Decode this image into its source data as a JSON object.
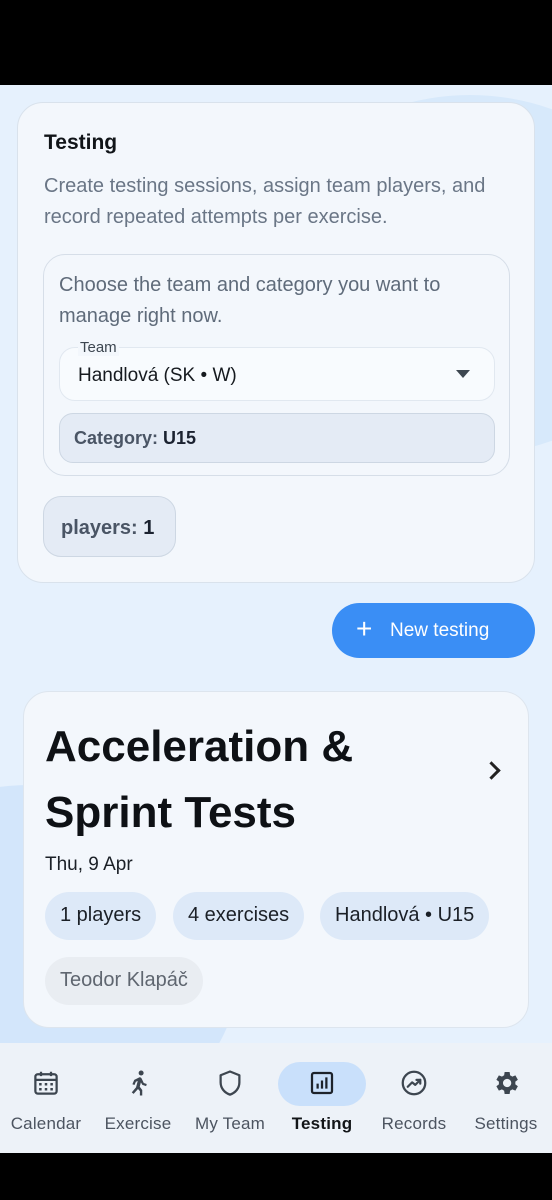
{
  "testing_card": {
    "title": "Testing",
    "description": "Create testing sessions, assign team players, and record repeated attempts per exercise.",
    "selector": {
      "description": "Choose the team and category you want to manage right now.",
      "team_label": "Team",
      "team_value": "Handlová (SK • W)",
      "category_label": "Category:",
      "category_value": "U15"
    },
    "players_label": "players:",
    "players_count": "1"
  },
  "new_testing_button": {
    "icon": "plus-icon",
    "label": "New testing"
  },
  "session": {
    "title": "Acceleration & Sprint Tests",
    "date": "Thu, 9 Apr",
    "players": "1 players",
    "exercises": "4 exercises",
    "team": "Handlová • U15",
    "coach": "Teodor Klapáč"
  },
  "nav": {
    "items": [
      {
        "label": "Calendar",
        "icon": "calendar-icon"
      },
      {
        "label": "Exercise",
        "icon": "running-icon"
      },
      {
        "label": "My Team",
        "icon": "shield-icon"
      },
      {
        "label": "Testing",
        "icon": "chart-icon",
        "active": true
      },
      {
        "label": "Records",
        "icon": "trending-icon"
      },
      {
        "label": "Settings",
        "icon": "gear-icon"
      }
    ]
  },
  "colors": {
    "accent": "#3a8ef5",
    "background": "#e6f1fd",
    "nav_active_pill": "#c9e0fb"
  }
}
